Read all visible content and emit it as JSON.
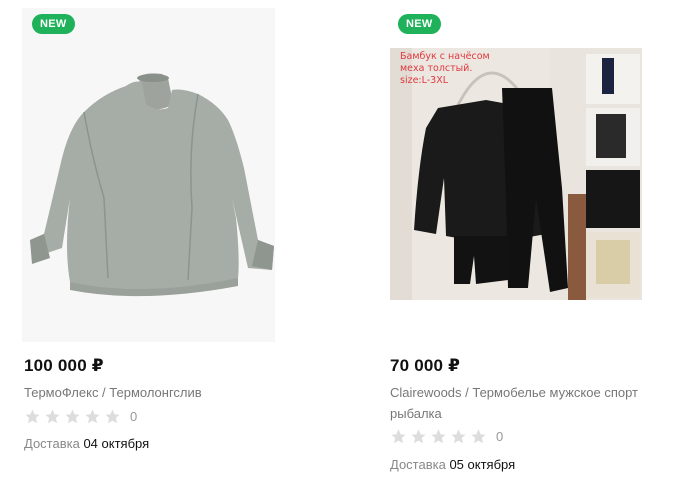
{
  "products": [
    {
      "badge": "NEW",
      "price": "100 000 ₽",
      "title": "ТермоФлекс / Термолонгслив",
      "rating_count": "0",
      "delivery_label": "Доставка",
      "delivery_date": "04 октября"
    },
    {
      "badge": "NEW",
      "price": "70 000 ₽",
      "title": "Clairewoods / Термобелье мужское спорт рыбалка",
      "rating_count": "0",
      "delivery_label": "Доставка",
      "delivery_date": "05 октября",
      "photo_text": [
        "Бамбук с начёсом",
        "меха толстый.",
        "size:L-3XL"
      ]
    }
  ],
  "colors": {
    "badge": "#1fb25a",
    "star_empty": "#dddddd",
    "photo_text": "#e0383e"
  }
}
